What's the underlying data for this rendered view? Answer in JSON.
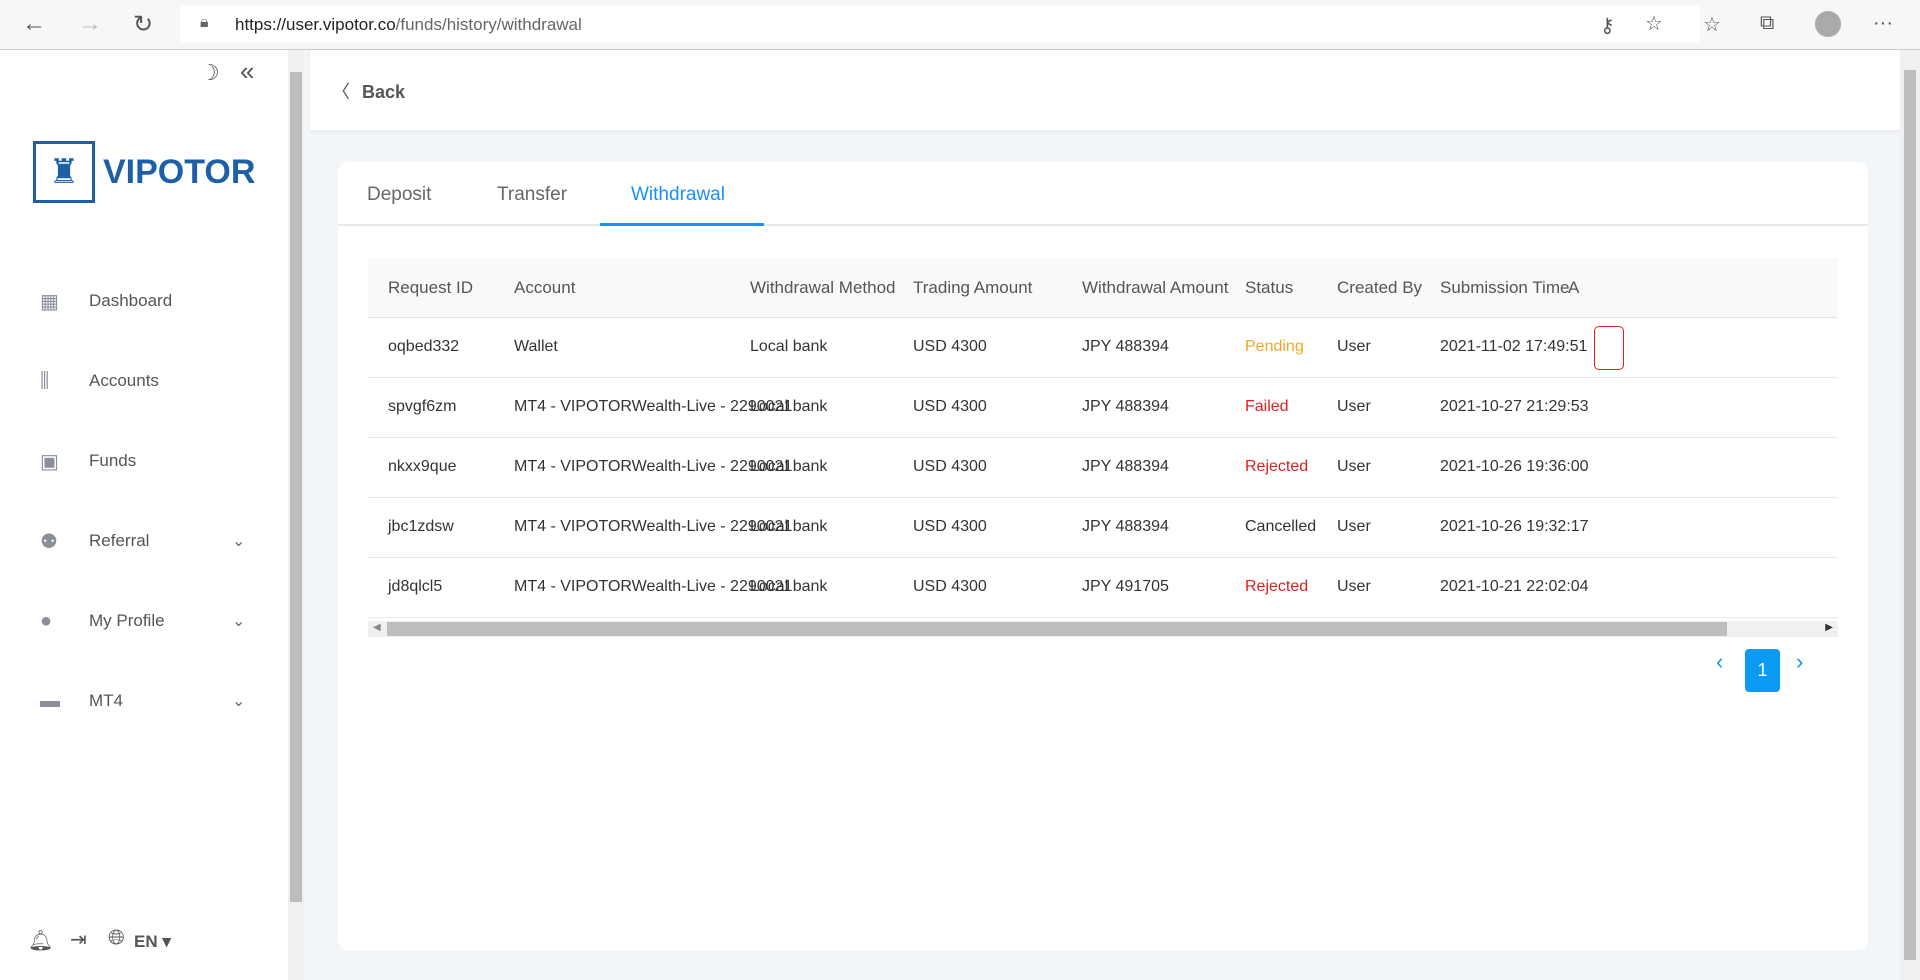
{
  "browser": {
    "url_host": "https://user.vipotor.co",
    "url_path": "/funds/history/withdrawal"
  },
  "sidebar": {
    "logo": "VIPOTOR",
    "items": [
      {
        "label": "Dashboard",
        "icon": "dashboard-icon"
      },
      {
        "label": "Accounts",
        "icon": "accounts-icon"
      },
      {
        "label": "Funds",
        "icon": "wallet-icon"
      },
      {
        "label": "Referral",
        "icon": "referral-icon"
      },
      {
        "label": "My Profile",
        "icon": "user-icon"
      },
      {
        "label": "MT4",
        "icon": "mt4-icon"
      }
    ],
    "language": "EN"
  },
  "header": {
    "back_label": "Back"
  },
  "tabs": [
    "Deposit",
    "Transfer",
    "Withdrawal"
  ],
  "table": {
    "columns": [
      "Request ID",
      "Account",
      "Withdrawal Method",
      "Trading Amount",
      "Withdrawal Amount",
      "Status",
      "Created By",
      "Submission Time",
      "A"
    ],
    "rows": [
      [
        "oqbed332",
        "Wallet",
        "Local bank",
        "USD 4300",
        "JPY 488394",
        "Pending",
        "User",
        "2021-11-02 17:49:51"
      ],
      [
        "spvgf6zm",
        "MT4 - VIPOTORWealth-Live - 2290021",
        "Local bank",
        "USD 4300",
        "JPY 488394",
        "Failed",
        "User",
        "2021-10-27 21:29:53"
      ],
      [
        "nkxx9que",
        "MT4 - VIPOTORWealth-Live - 2290021",
        "Local bank",
        "USD 4300",
        "JPY 488394",
        "Rejected",
        "User",
        "2021-10-26 19:36:00"
      ],
      [
        "jbc1zdsw",
        "MT4 - VIPOTORWealth-Live - 2290021",
        "Local bank",
        "USD 4300",
        "JPY 488394",
        "Cancelled",
        "User",
        "2021-10-26 19:32:17"
      ],
      [
        "jd8qlcl5",
        "MT4 - VIPOTORWealth-Live - 2290021",
        "Local bank",
        "USD 4300",
        "JPY 491705",
        "Rejected",
        "User",
        "2021-10-21 22:02:04"
      ]
    ]
  },
  "status_colors": {
    "Pending": "#f5a623",
    "Failed": "#e02020",
    "Rejected": "#e02020",
    "Cancelled": "#333333"
  },
  "pagination": {
    "current": "1"
  }
}
